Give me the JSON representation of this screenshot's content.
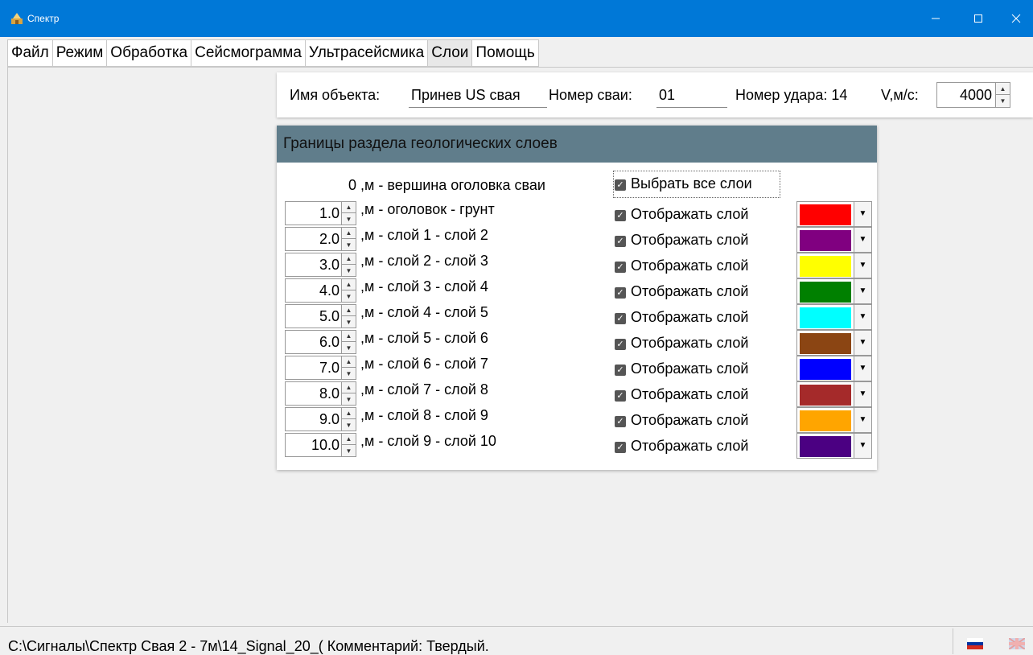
{
  "window": {
    "title": "Спектр"
  },
  "menu": [
    "Файл",
    "Режим",
    "Обработка",
    "Сейсмограмма",
    "Ультрасейсмика",
    "Слои",
    "Помощь"
  ],
  "object": {
    "name_label": "Имя объекта:",
    "name_value": "Принев US свая",
    "pile_label": "Номер сваи:",
    "pile_value": "01",
    "hit_label": "Номер удара: 14",
    "v_label": "V,м/с:",
    "v_value": "4000"
  },
  "layers_panel": {
    "header": "Границы раздела геологических слоев",
    "top_value": "0",
    "top_label": ",м - вершина оголовка сваи",
    "select_all": "Выбрать все слои",
    "rows": [
      {
        "value": "1.0",
        "label": ",м - оголовок - грунт",
        "check": "Отображать слой",
        "color": "#ff0000"
      },
      {
        "value": "2.0",
        "label": ",м - слой 1 - слой 2",
        "check": "Отображать слой",
        "color": "#800080"
      },
      {
        "value": "3.0",
        "label": ",м - слой 2 - слой 3",
        "check": "Отображать слой",
        "color": "#ffff00"
      },
      {
        "value": "4.0",
        "label": ",м - слой 3 - слой 4",
        "check": "Отображать слой",
        "color": "#008000"
      },
      {
        "value": "5.0",
        "label": ",м - слой 4 - слой 5",
        "check": "Отображать слой",
        "color": "#00ffff"
      },
      {
        "value": "6.0",
        "label": ",м - слой 5 - слой 6",
        "check": "Отображать слой",
        "color": "#8b4513"
      },
      {
        "value": "7.0",
        "label": ",м - слой 6 - слой 7",
        "check": "Отображать слой",
        "color": "#0000ff"
      },
      {
        "value": "8.0",
        "label": ",м - слой 7 - слой 8",
        "check": "Отображать слой",
        "color": "#a52a2a"
      },
      {
        "value": "9.0",
        "label": ",м - слой 8 - слой 9",
        "check": "Отображать слой",
        "color": "#ffa500"
      },
      {
        "value": "10.0",
        "label": ",м - слой 9 - слой 10",
        "check": "Отображать слой",
        "color": "#4b0082"
      }
    ]
  },
  "status": {
    "path": "C:\\Сигналы\\Спектр Свая 2 - 7м\\14_Signal_20_( Комментарий: Твердый."
  }
}
